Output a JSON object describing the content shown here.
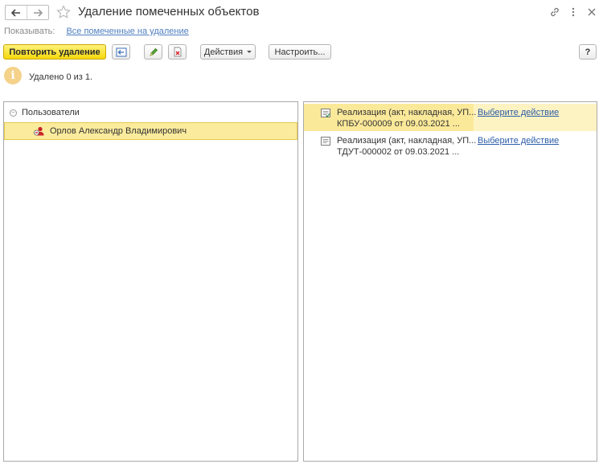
{
  "window": {
    "title": "Удаление помеченных объектов"
  },
  "toolbar": {
    "show_label": "Показывать:",
    "show_link": "Все помеченные на удаление",
    "repeat_delete": "Повторить удаление",
    "actions": "Действия",
    "configure": "Настроить...",
    "help": "?"
  },
  "info": {
    "text": "Удалено 0 из 1."
  },
  "left_tree": {
    "group": "Пользователи",
    "items": [
      {
        "label": "Орлов Александр Владимирович"
      }
    ]
  },
  "right_list": {
    "items": [
      {
        "line1": "Реализация (акт, накладная, УП...",
        "line2": "КПБУ-000009 от 09.03.2021 ...",
        "action": "Выберите действие"
      },
      {
        "line1": "Реализация (акт, накладная, УП...",
        "line2": "ТДУТ-000002 от 09.03.2021 ...",
        "action": "Выберите действие"
      }
    ]
  },
  "icons": {
    "back": "arrow-left-icon",
    "forward": "arrow-right-icon",
    "favorite": "star-icon",
    "link": "link-icon",
    "more": "more-vertical-icon",
    "close": "close-icon",
    "user": "user-icon",
    "document": "document-icon"
  },
  "colors": {
    "primary_button": "#f5d80a",
    "selected_row": "#fbeb9c",
    "link": "#2c5ca8"
  }
}
